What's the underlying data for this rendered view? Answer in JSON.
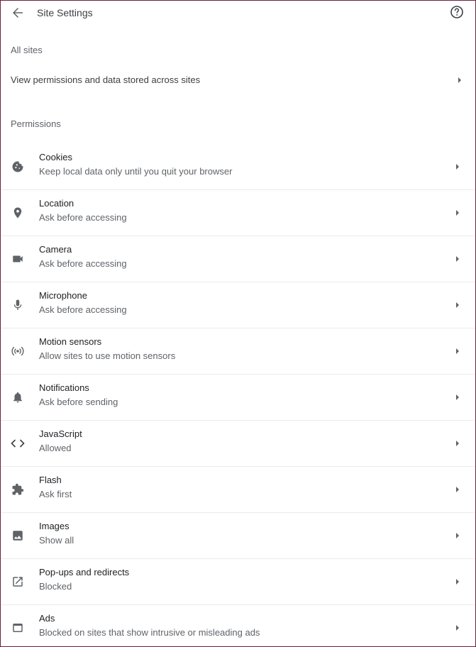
{
  "header": {
    "title": "Site Settings",
    "back_icon": "arrow-back-icon",
    "help_icon": "help-icon"
  },
  "all_sites": {
    "section_label": "All sites",
    "row_label": "View permissions and data stored across sites"
  },
  "permissions": {
    "section_label": "Permissions",
    "items": [
      {
        "title": "Cookies",
        "subtitle": "Keep local data only until you quit your browser",
        "icon": "cookie-icon"
      },
      {
        "title": "Location",
        "subtitle": "Ask before accessing",
        "icon": "location-pin-icon"
      },
      {
        "title": "Camera",
        "subtitle": "Ask before accessing",
        "icon": "camera-icon"
      },
      {
        "title": "Microphone",
        "subtitle": "Ask before accessing",
        "icon": "microphone-icon"
      },
      {
        "title": "Motion sensors",
        "subtitle": "Allow sites to use motion sensors",
        "icon": "motion-sensor-icon"
      },
      {
        "title": "Notifications",
        "subtitle": "Ask before sending",
        "icon": "bell-icon"
      },
      {
        "title": "JavaScript",
        "subtitle": "Allowed",
        "icon": "code-icon"
      },
      {
        "title": "Flash",
        "subtitle": "Ask first",
        "icon": "puzzle-icon"
      },
      {
        "title": "Images",
        "subtitle": "Show all",
        "icon": "image-icon"
      },
      {
        "title": "Pop-ups and redirects",
        "subtitle": "Blocked",
        "icon": "open-in-new-icon"
      },
      {
        "title": "Ads",
        "subtitle": "Blocked on sites that show intrusive or misleading ads",
        "icon": "ads-window-icon"
      }
    ]
  },
  "colors": {
    "frame_border": "#6d1f3a",
    "icon": "#5f6368",
    "divider": "#ebebeb"
  }
}
